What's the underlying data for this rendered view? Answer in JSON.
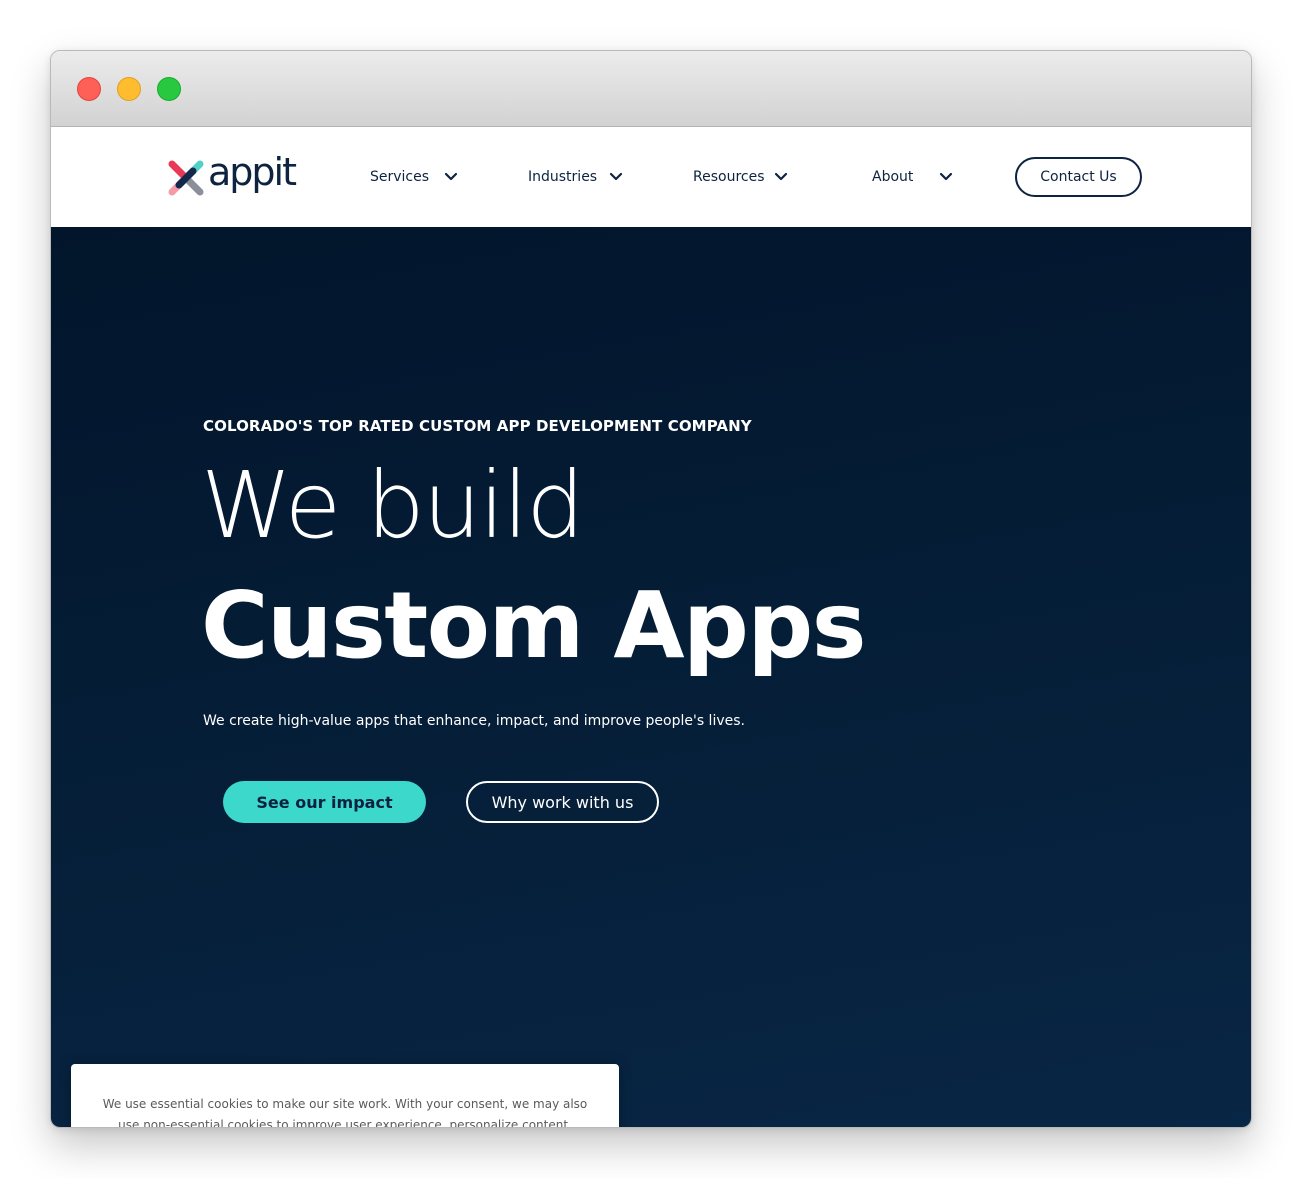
{
  "window": {
    "traffic_lights": [
      "close",
      "minimize",
      "maximize"
    ]
  },
  "nav": {
    "logo_text": "appit",
    "items": [
      {
        "label": "Services"
      },
      {
        "label": "Industries"
      },
      {
        "label": "Resources"
      },
      {
        "label": "About"
      }
    ],
    "contact_label": "Contact Us"
  },
  "hero": {
    "eyebrow": "COLORADO'S TOP RATED CUSTOM APP DEVELOPMENT COMPANY",
    "headline_light": "We build",
    "headline_bold": "Custom Apps",
    "subline": "We create high-value apps that enhance, impact, and improve people's lives.",
    "primary_button": "See our impact",
    "secondary_button": "Why work with us"
  },
  "cookie": {
    "text": "We use essential cookies to make our site work. With your consent, we may also use non-essential cookies to improve user experience, personalize content, customize"
  },
  "colors": {
    "navy": "#0e2340",
    "hero_bg": "#051d36",
    "teal": "#3cd8cc",
    "logo_red": "#e83a56",
    "logo_pink": "#f49aa8",
    "logo_teal": "#4fd1c8",
    "logo_dark": "#13294b",
    "logo_gray": "#8a8f99"
  }
}
